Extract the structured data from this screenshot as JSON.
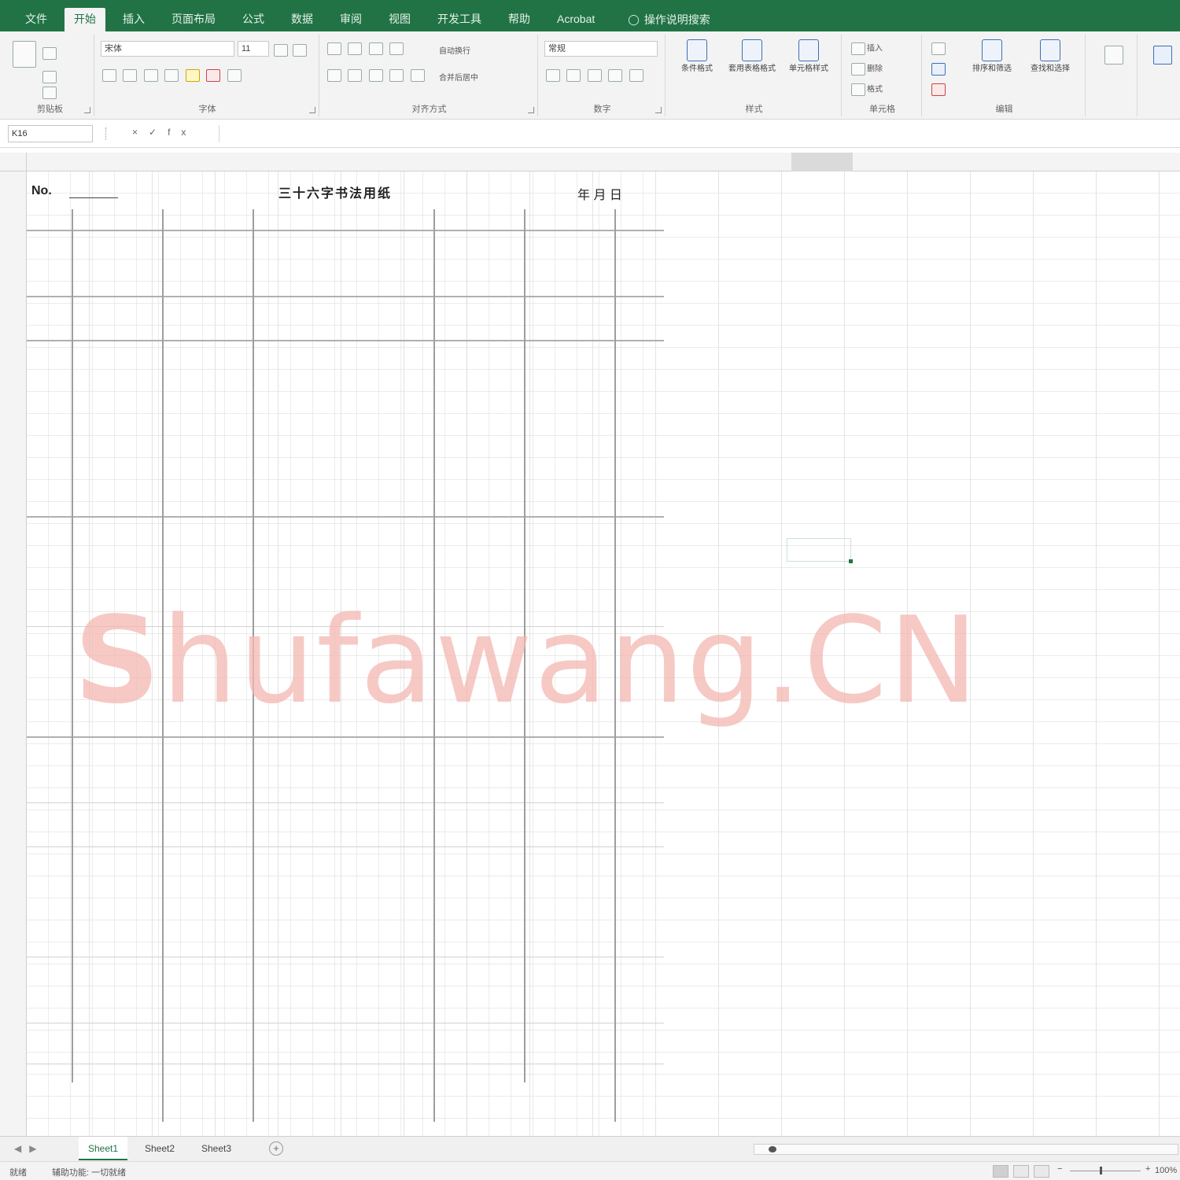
{
  "tabs": {
    "items": [
      "文件",
      "开始",
      "插入",
      "页面布局",
      "公式",
      "数据",
      "审阅",
      "视图",
      "开发工具",
      "帮助",
      "Acrobat",
      "操作说明搜索"
    ],
    "active_index": 1
  },
  "ribbon": {
    "font_name": "宋体",
    "font_size": "11",
    "number_format": "常规",
    "wrap_text": "自动换行",
    "merge_center": "合并后居中",
    "groups": [
      "剪贴板",
      "字体",
      "对齐方式",
      "数字",
      "样式",
      "单元格",
      "编辑"
    ],
    "styles": [
      "条件格式",
      "套用表格格式",
      "单元格样式"
    ],
    "cells": [
      "插入",
      "删除",
      "格式"
    ],
    "editing": [
      "排序和筛选",
      "查找和选择"
    ]
  },
  "formula_bar": {
    "name_box": "K16",
    "fx_label": "fx",
    "content": ""
  },
  "sheet": {
    "header_left": "No.",
    "header_mid": "三十六字书法用纸",
    "header_right": "年  月  日"
  },
  "watermark": {
    "text_bold": "S",
    "text_rest": "hufawang.CN"
  },
  "sheet_tabs": {
    "items": [
      "Sheet1",
      "Sheet2",
      "Sheet3"
    ],
    "active_index": 0,
    "add_label": "+"
  },
  "status": {
    "ready": "就绪",
    "accessibility": "辅助功能: 一切就绪",
    "zoom": "100%"
  },
  "colors": {
    "brand": "#217346",
    "watermark": "#f3b8b2"
  }
}
